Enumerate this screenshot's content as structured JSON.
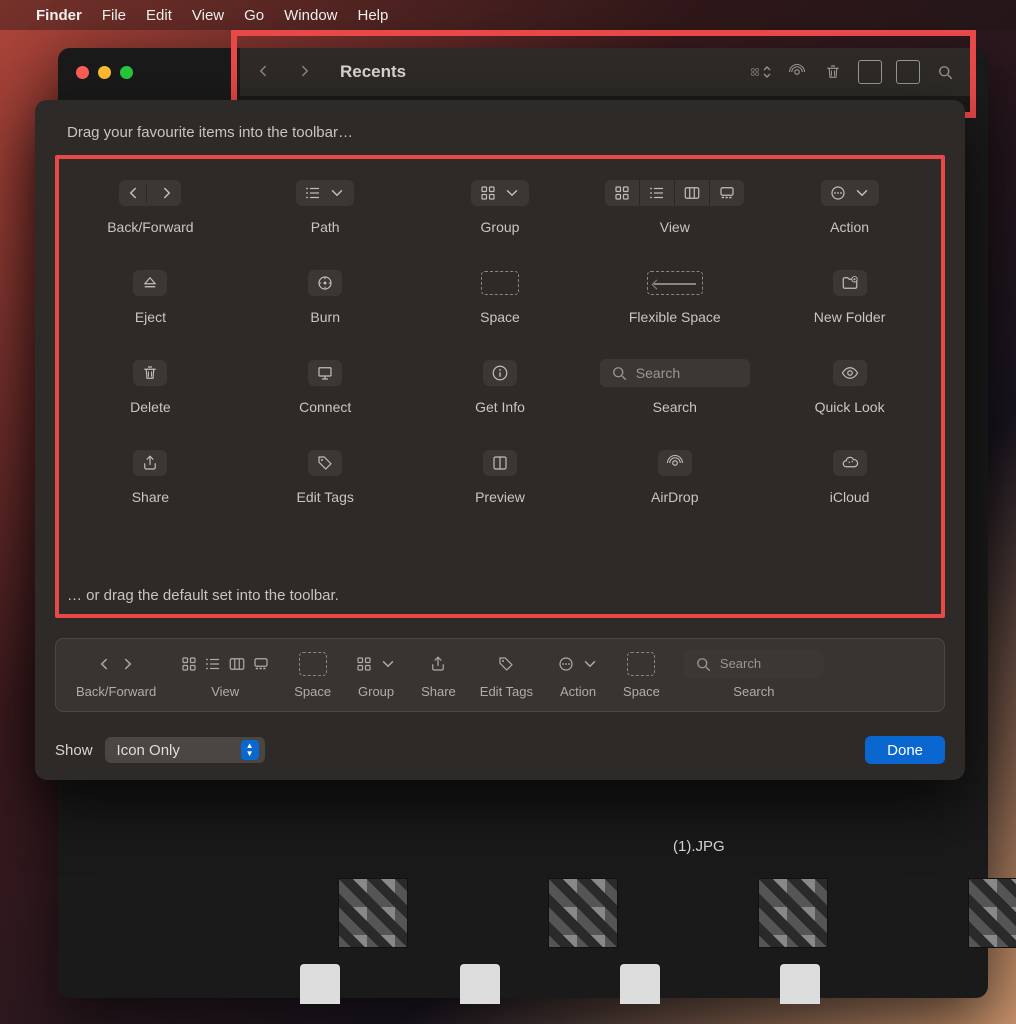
{
  "menubar": {
    "app": "Finder",
    "items": [
      "File",
      "Edit",
      "View",
      "Go",
      "Window",
      "Help"
    ]
  },
  "toolbar": {
    "title": "Recents"
  },
  "sheet": {
    "hint_top": "Drag your favourite items into the toolbar…",
    "hint_bottom": "… or drag the default set into the toolbar.",
    "items": {
      "back_forward": "Back/Forward",
      "path": "Path",
      "group": "Group",
      "view": "View",
      "action": "Action",
      "eject": "Eject",
      "burn": "Burn",
      "space": "Space",
      "flexible_space": "Flexible Space",
      "new_folder": "New Folder",
      "delete": "Delete",
      "connect": "Connect",
      "get_info": "Get Info",
      "search": "Search",
      "quick_look": "Quick Look",
      "share": "Share",
      "edit_tags": "Edit Tags",
      "preview": "Preview",
      "airdrop": "AirDrop",
      "icloud": "iCloud"
    },
    "search_placeholder": "Search",
    "default_set": {
      "back_forward": "Back/Forward",
      "view": "View",
      "space": "Space",
      "group": "Group",
      "share": "Share",
      "edit_tags": "Edit Tags",
      "action": "Action",
      "space2": "Space",
      "search": "Search"
    },
    "show_label": "Show",
    "show_value": "Icon Only",
    "done": "Done"
  },
  "files": {
    "visible_name": "(1).JPG"
  }
}
